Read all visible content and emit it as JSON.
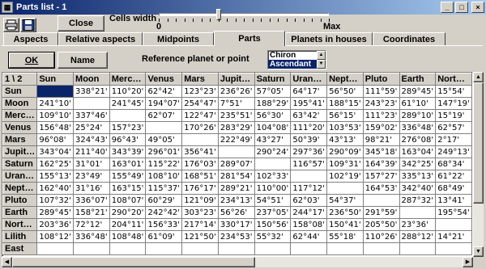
{
  "window": {
    "title": "Parts list - 1",
    "minimize": "_",
    "maximize": "□",
    "close": "×"
  },
  "toolbar": {
    "close_label": "Close",
    "cells_width_label": "Cells width",
    "slider_min": "0",
    "slider_max": "Max",
    "slider_value": 0.35
  },
  "tabs": [
    "Aspects",
    "Relative aspects",
    "Midpoints",
    "Parts",
    "Planets in houses",
    "Coordinates"
  ],
  "active_tab": "Parts",
  "controls": {
    "ok_label": "OK",
    "name_label": "Name",
    "reference_label": "Reference planet or point",
    "reference_options": [
      "Chiron",
      "Ascendant"
    ],
    "reference_selected": "Ascendant"
  },
  "grid": {
    "corner": "1 \\ 2",
    "columns": [
      "Sun",
      "Moon",
      "Merc…",
      "Venus",
      "Mars",
      "Jupit…",
      "Saturn",
      "Uran…",
      "Nept…",
      "Pluto",
      "Earth",
      "Nort…"
    ],
    "rows": [
      {
        "name": "Sun",
        "cells": [
          "",
          "338°21'",
          "110°20'",
          "62°42'",
          "123°23'",
          "236°26'",
          "57°05'",
          "64°17'",
          "56°50'",
          "111°59'",
          "289°45'",
          "15°54'"
        ]
      },
      {
        "name": "Moon",
        "cells": [
          "241°10'",
          "",
          "241°45'",
          "194°07'",
          "254°47'",
          "7°51'",
          "188°29'",
          "195°41'",
          "188°15'",
          "243°23'",
          "61°10'",
          "147°19'"
        ]
      },
      {
        "name": "Merc…",
        "cells": [
          "109°10'",
          "337°46'",
          "",
          "62°07'",
          "122°47'",
          "235°51'",
          "56°30'",
          "63°42'",
          "56°15'",
          "111°23'",
          "289°10'",
          "15°19'"
        ]
      },
      {
        "name": "Venus",
        "cells": [
          "156°48'",
          "25°24'",
          "157°23'",
          "",
          "170°26'",
          "283°29'",
          "104°08'",
          "111°20'",
          "103°53'",
          "159°02'",
          "336°48'",
          "62°57'"
        ]
      },
      {
        "name": "Mars",
        "cells": [
          "96°08'",
          "324°43'",
          "96°43'",
          "49°05'",
          "",
          "222°49'",
          "43°27'",
          "50°39'",
          "43°13'",
          "98°21'",
          "276°08'",
          "2°17'"
        ]
      },
      {
        "name": "Jupit…",
        "cells": [
          "343°04'",
          "211°40'",
          "343°39'",
          "296°01'",
          "356°41'",
          "",
          "290°24'",
          "297°36'",
          "290°09'",
          "345°18'",
          "163°04'",
          "249°13'"
        ]
      },
      {
        "name": "Saturn",
        "cells": [
          "162°25'",
          "31°01'",
          "163°01'",
          "115°22'",
          "176°03'",
          "289°07'",
          "",
          "116°57'",
          "109°31'",
          "164°39'",
          "342°25'",
          "68°34'"
        ]
      },
      {
        "name": "Uran…",
        "cells": [
          "155°13'",
          "23°49'",
          "155°49'",
          "108°10'",
          "168°51'",
          "281°54'",
          "102°33'",
          "",
          "102°19'",
          "157°27'",
          "335°13'",
          "61°22'"
        ]
      },
      {
        "name": "Nept…",
        "cells": [
          "162°40'",
          "31°16'",
          "163°15'",
          "115°37'",
          "176°17'",
          "289°21'",
          "110°00'",
          "117°12'",
          "",
          "164°53'",
          "342°40'",
          "68°49'"
        ]
      },
      {
        "name": "Pluto",
        "cells": [
          "107°32'",
          "336°07'",
          "108°07'",
          "60°29'",
          "121°09'",
          "234°13'",
          "54°51'",
          "62°03'",
          "54°37'",
          "",
          "287°32'",
          "13°41'"
        ]
      },
      {
        "name": "Earth",
        "cells": [
          "289°45'",
          "158°21'",
          "290°20'",
          "242°42'",
          "303°23'",
          "56°26'",
          "237°05'",
          "244°17'",
          "236°50'",
          "291°59'",
          "",
          "195°54'"
        ]
      },
      {
        "name": "Nort…",
        "cells": [
          "203°36'",
          "72°12'",
          "204°11'",
          "156°33'",
          "217°14'",
          "330°17'",
          "150°56'",
          "158°08'",
          "150°41'",
          "205°50'",
          "23°36'",
          ""
        ]
      },
      {
        "name": "Lilith",
        "cells": [
          "108°12'",
          "336°48'",
          "108°48'",
          "61°09'",
          "121°50'",
          "234°53'",
          "55°32'",
          "62°44'",
          "55°18'",
          "110°26'",
          "288°12'",
          "14°21'"
        ]
      },
      {
        "name": "East",
        "cells": [
          "",
          "",
          "",
          "",
          "",
          "",
          "",
          "",
          "",
          "",
          "",
          ""
        ]
      }
    ]
  }
}
